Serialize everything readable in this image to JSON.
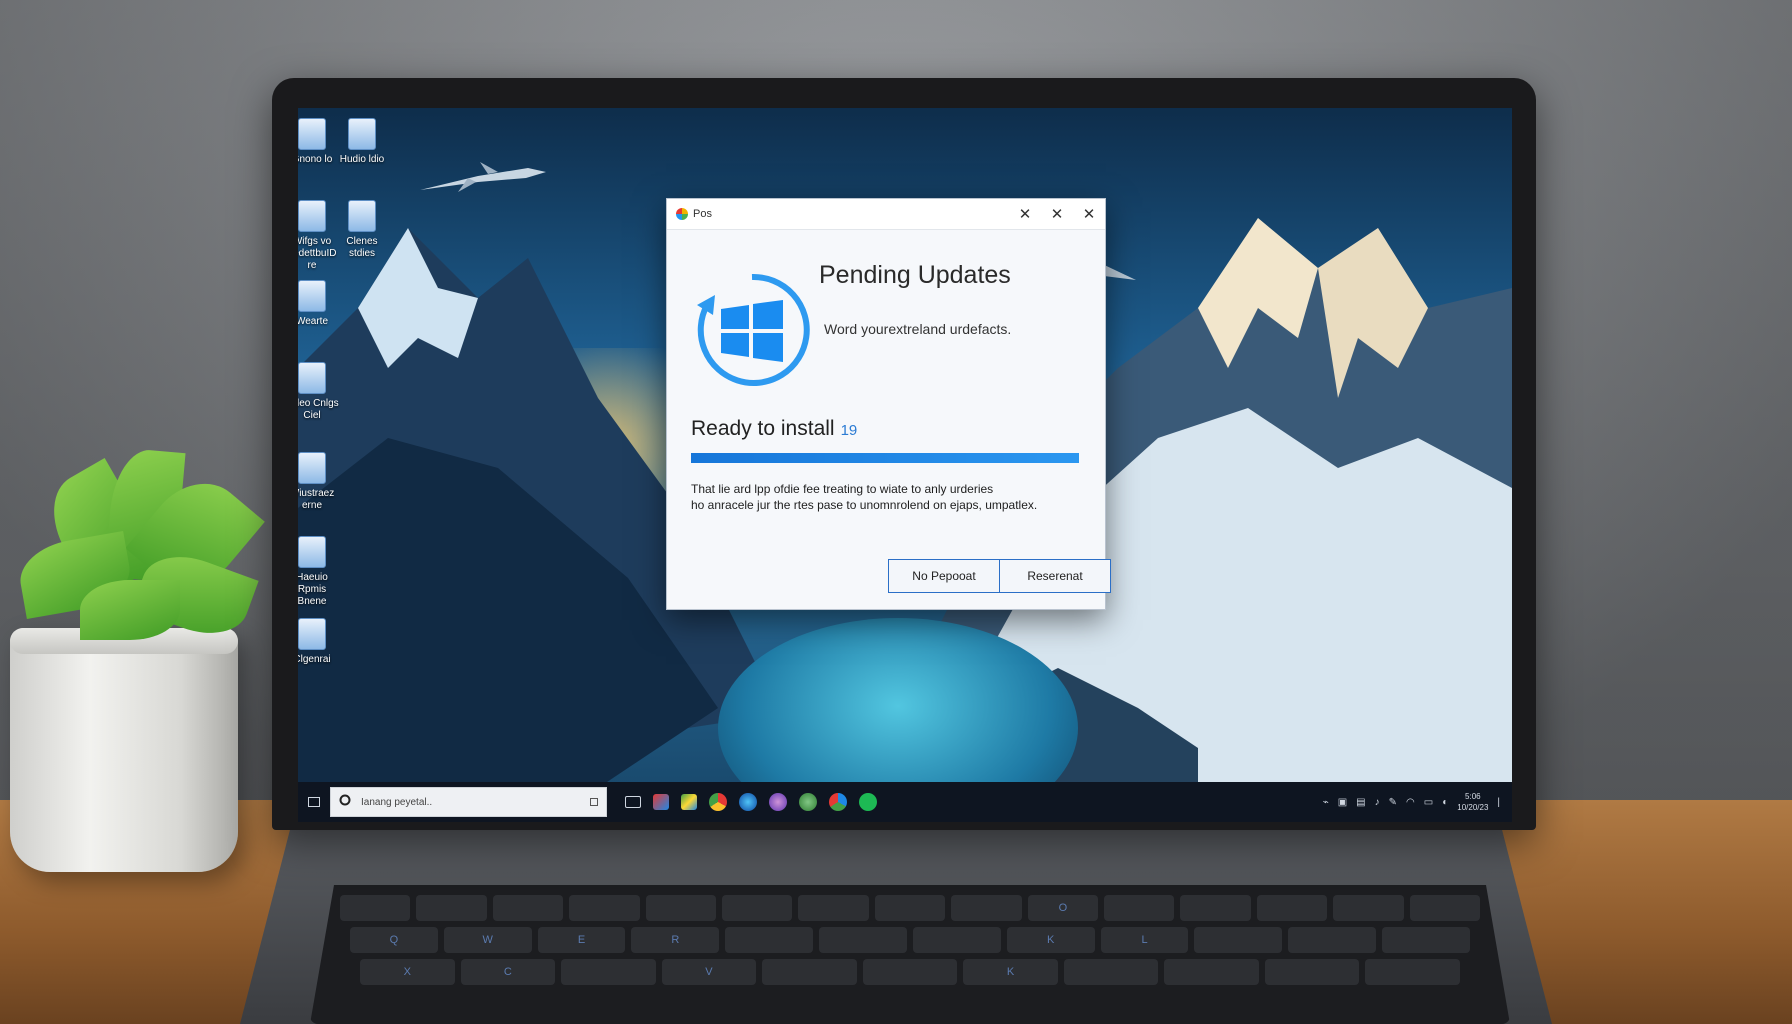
{
  "desktop": {
    "icons": [
      {
        "label": "Gnono lo"
      },
      {
        "label": "Hudio ldio"
      },
      {
        "label": "Wifgs vo pedettbuID re"
      },
      {
        "label": "Clenes stdies"
      },
      {
        "label": "Wearte"
      },
      {
        "label": "Fldeo Cnlgs Ciel"
      },
      {
        "label": "Wiustraez erne"
      },
      {
        "label": "Haeuio Rpmis Bnene"
      },
      {
        "label": "Clgenrai"
      }
    ]
  },
  "dialog": {
    "window_title": "Pos",
    "minimize_glyph": "✕",
    "maximize_glyph": "✕",
    "close_glyph": "✕",
    "title": "Pending Updates",
    "subtitle": "Word yourextreland urdefacts.",
    "status_label": "Ready to install",
    "status_count": "19",
    "progress_percent": 100,
    "body_line1": "That lie ard lpp ofdie fee treating to wiate to anly urderies",
    "body_line2": "ho anracele jur the rtes pase to unomnrolend on ejaps, umpatlex.",
    "button_left": "No Pepooat",
    "button_right": "Reserenat"
  },
  "taskbar": {
    "search_value": "Ianang peyetal..",
    "clock_time": "5:06",
    "clock_date": "10/20/23"
  },
  "keyboard": {
    "row_top": [
      "",
      "",
      "",
      "",
      "",
      "",
      "",
      "",
      "",
      "O",
      "",
      "",
      "",
      "",
      ""
    ],
    "row_q": [
      "Q",
      "W",
      "E",
      "R",
      "",
      "",
      "",
      "K",
      "L",
      "",
      "",
      ""
    ],
    "row_z": [
      "X",
      "C",
      "",
      "V",
      "",
      "",
      "K",
      "",
      "",
      "",
      ""
    ]
  },
  "colors": {
    "accent": "#1676d9",
    "dialog_bg": "#f6f8fb",
    "taskbar_bg": "#0e1521"
  }
}
